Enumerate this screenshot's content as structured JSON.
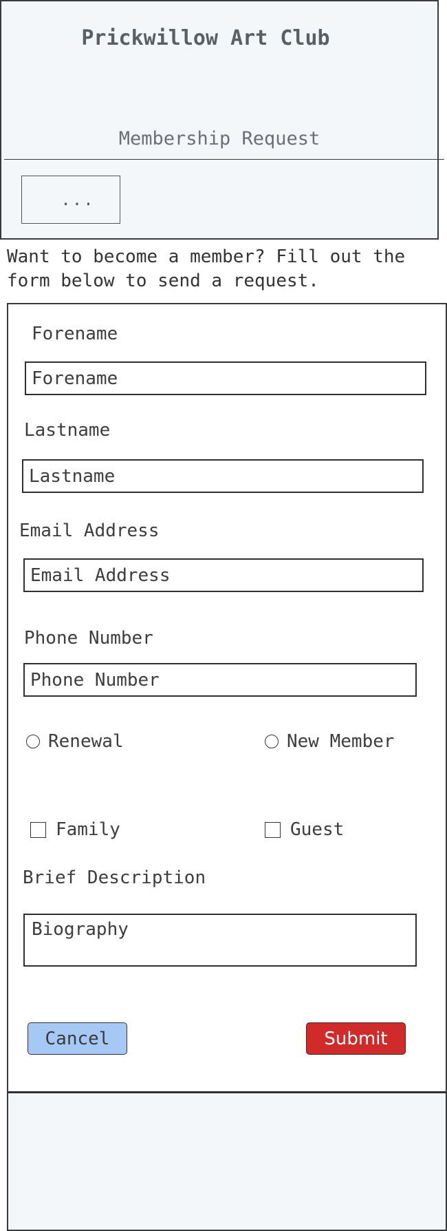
{
  "header": {
    "title": "Prickwillow Art Club",
    "subtitle": "Membership Request",
    "menu_label": "..."
  },
  "intro": {
    "text": "Want to become a member? Fill out the form below to send a request."
  },
  "form": {
    "forename": {
      "label": "Forename",
      "placeholder": "Forename",
      "value": ""
    },
    "lastname": {
      "label": "Lastname",
      "placeholder": "Lastname",
      "value": ""
    },
    "email": {
      "label": "Email Address",
      "placeholder": "Email Address",
      "value": ""
    },
    "phone": {
      "label": "Phone Number",
      "placeholder": "Phone Number",
      "value": ""
    },
    "membership_type": {
      "options": [
        {
          "label": "Renewal",
          "selected": false
        },
        {
          "label": "New Member",
          "selected": false
        }
      ]
    },
    "extras": {
      "options": [
        {
          "label": "Family",
          "checked": false
        },
        {
          "label": "Guest",
          "checked": false
        }
      ]
    },
    "description": {
      "label": "Brief Description",
      "placeholder": "Biography",
      "value": ""
    },
    "buttons": {
      "cancel": "Cancel",
      "submit": "Submit"
    }
  },
  "colors": {
    "header_bg": "#f4f7fa",
    "cancel_bg": "#a6c8f5",
    "submit_bg": "#d12a2a",
    "border": "#2f2f2f"
  }
}
